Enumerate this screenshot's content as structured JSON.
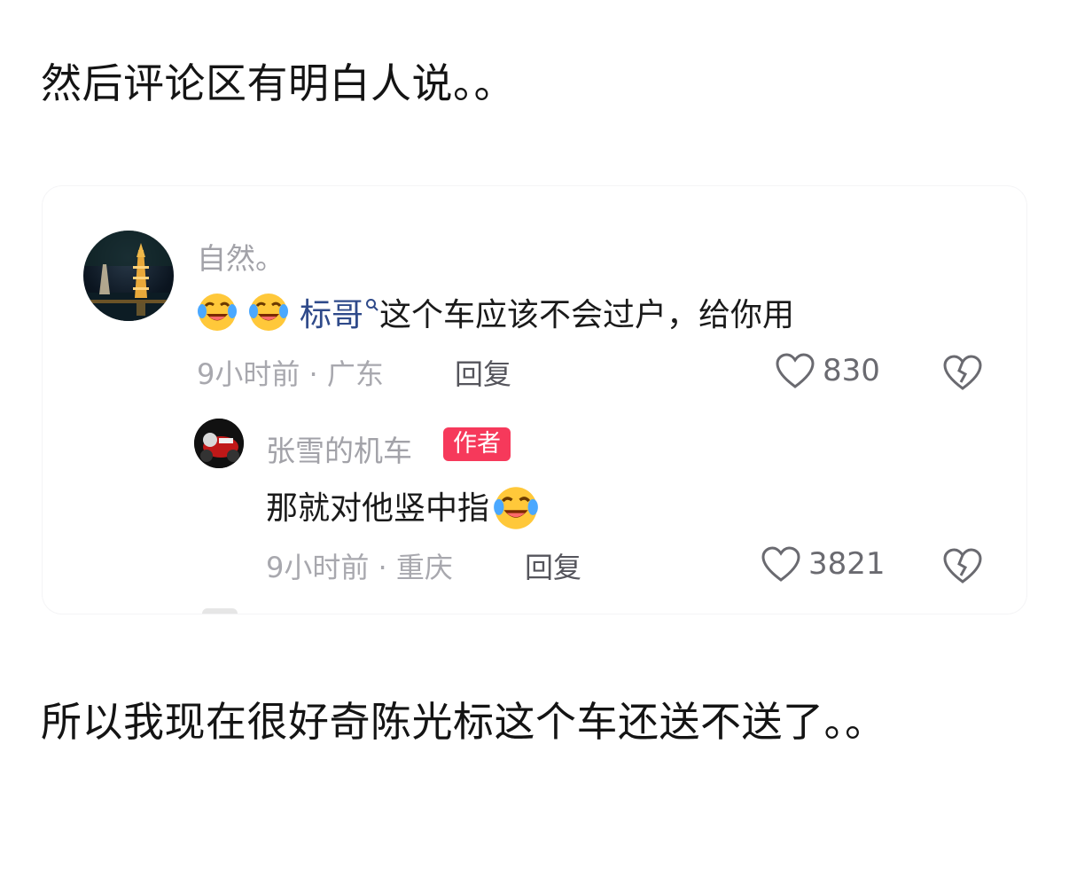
{
  "post": {
    "intro": "然后评论区有明白人说。。",
    "outro": "所以我现在很好奇陈光标这个车还送不送了。。"
  },
  "comment": {
    "username": "自然。",
    "mention": "标哥",
    "text": "这个车应该不会过户，给你用",
    "time_location": "9小时前 · 广东",
    "reply_label": "回复",
    "likes": "830"
  },
  "reply": {
    "username": "张雪的机车",
    "badge": "作者",
    "text": "那就对他竖中指",
    "time_location": "9小时前 · 重庆",
    "reply_label": "回复",
    "likes": "3821"
  },
  "icons": {
    "emoji": "laughing-crying-emoji",
    "mention": "search-icon",
    "like": "heart-outline-icon",
    "dislike": "broken-heart-icon"
  },
  "colors": {
    "mention": "#2f4a8a",
    "badge": "#f6395b",
    "meta": "#a8a8ae"
  }
}
